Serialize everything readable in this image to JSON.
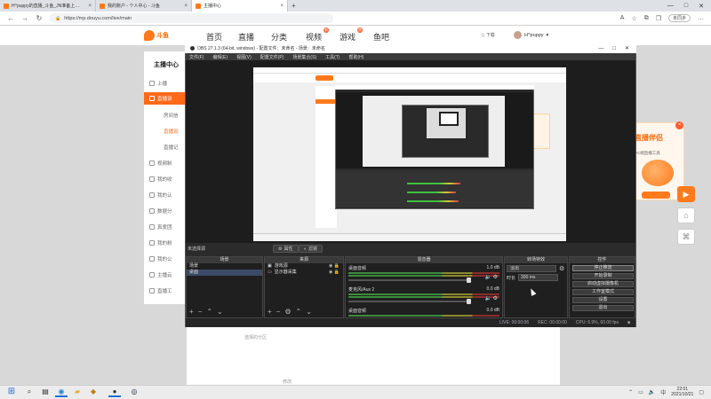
{
  "browser": {
    "tabs": [
      {
        "title": "H^puppy的直播_斗鱼_JN准备上…",
        "active": false
      },
      {
        "title": "我的账户 - 个人中心 - 斗鱼",
        "active": false
      },
      {
        "title": "主播中心",
        "active": true
      }
    ],
    "url": "https://mp.douyu.com/live/main",
    "sync_label": "未同步"
  },
  "site": {
    "logo_text": "斗鱼",
    "nav": [
      "首页",
      "直播",
      "分类",
      "视频",
      "游戏",
      "鱼吧"
    ],
    "nav_badges": {
      "视频": "新",
      "游戏": "热"
    },
    "download_label": "下载",
    "username": "H^puppy",
    "menu_title": "主播中心",
    "menu_items": [
      "上播",
      "直播设",
      "房间信",
      "直播设",
      "直播记",
      "视频制",
      "我的收",
      "我的认",
      "数据分",
      "真爱团",
      "我的粉",
      "我的公",
      "主播云",
      "直播工"
    ],
    "menu_active": "直播设",
    "below_text_1": "选择的分区",
    "below_text_2": "修改",
    "promo_title": "直播伴侣",
    "promo_sub": "PC端直播工具"
  },
  "obs": {
    "title": "OBS 27.1.3 (64-bit, windows) - 配置文件：未命名 - 场景：未命名",
    "menu": [
      "文件(F)",
      "编辑(E)",
      "视图(V)",
      "配置文件(P)",
      "场景集合(S)",
      "工具(T)",
      "帮助(H)"
    ],
    "scene_toolbar_label": "未选择源",
    "props_button": "属性",
    "filters_button": "滤镜",
    "panels": {
      "scenes": "场景",
      "sources": "来源",
      "mixer": "混音器",
      "transitions": "转场特效",
      "controls": "控件"
    },
    "scenes": [
      {
        "name": "场景",
        "selected": false
      },
      {
        "name": "桌面",
        "selected": true
      }
    ],
    "sources": [
      "游戏源",
      "显示器采集"
    ],
    "mixer": [
      {
        "name": "桌面音频",
        "db": "1.0 dB"
      },
      {
        "name": "麦克风/Aux 2",
        "db": "0.0 dB"
      },
      {
        "name": "桌面音频",
        "db": "0.0 dB"
      }
    ],
    "transition": {
      "type": "淡出",
      "duration_label": "时长",
      "duration": "300 ms"
    },
    "controls": [
      "停止推流",
      "开始录制",
      "启动虚拟摄像机",
      "工作室模式",
      "设置",
      "退出"
    ],
    "status": {
      "live": "LIVE: 00:00:06",
      "rec": "REC: 00:00:00",
      "cpu": "CPU: 6.9%, 60.00 fps"
    }
  },
  "taskbar": {
    "time": "22:01",
    "date": "2021/10/21"
  }
}
